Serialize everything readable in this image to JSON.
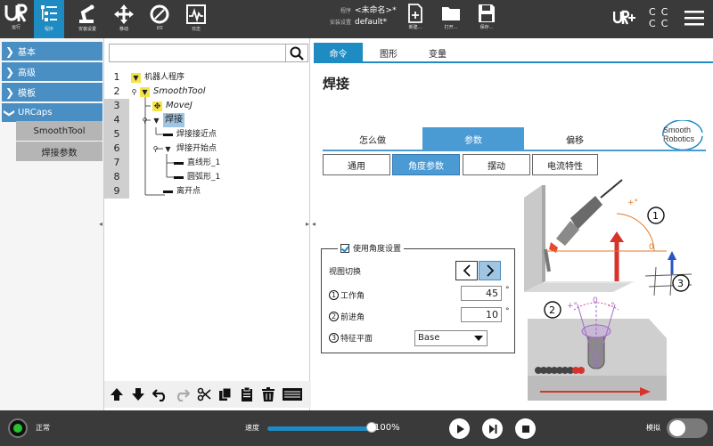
{
  "topbar": {
    "buttons": [
      {
        "label": "运行",
        "icon": "ur-logo-icon"
      },
      {
        "label": "程序",
        "icon": "program-icon"
      },
      {
        "label": "安装设置",
        "icon": "robot-arm-icon"
      },
      {
        "label": "移动",
        "icon": "move-arrows-icon"
      },
      {
        "label": "I/O",
        "icon": "io-icon"
      },
      {
        "label": "日志",
        "icon": "log-icon"
      }
    ],
    "program_key": "程序",
    "program_value": "<未命名>*",
    "install_key": "安装设置",
    "install_value": "default*",
    "file_buttons": [
      {
        "label": "新建...",
        "icon": "new-file-icon"
      },
      {
        "label": "打开...",
        "icon": "folder-icon"
      },
      {
        "label": "保存...",
        "icon": "save-icon"
      }
    ],
    "c_labels": [
      "C",
      "C",
      "C",
      "C"
    ]
  },
  "leftnav": {
    "items": [
      {
        "label": "基本",
        "expanded": false
      },
      {
        "label": "高级",
        "expanded": false
      },
      {
        "label": "模板",
        "expanded": false
      },
      {
        "label": "URCaps",
        "expanded": true
      }
    ],
    "sub_items": [
      "SmoothTool",
      "焊接参数"
    ]
  },
  "tree": {
    "rows": [
      {
        "num": "1",
        "label": "机器人程序"
      },
      {
        "num": "2",
        "label": "SmoothTool"
      },
      {
        "num": "3",
        "label": "MoveJ"
      },
      {
        "num": "4",
        "label": "焊接"
      },
      {
        "num": "5",
        "label": "焊接接近点"
      },
      {
        "num": "6",
        "label": "焊接开始点"
      },
      {
        "num": "7",
        "label": "直线形_1"
      },
      {
        "num": "8",
        "label": "圆弧形_1"
      },
      {
        "num": "9",
        "label": "离开点"
      }
    ]
  },
  "main": {
    "tabs": [
      "命令",
      "图形",
      "变量"
    ],
    "title": "焊接",
    "logo_line1": "Smooth",
    "logo_line2": "Robotics",
    "big_tabs": [
      "怎么做",
      "参数",
      "偏移"
    ],
    "small_tabs": [
      "通用",
      "角度参数",
      "摆动",
      "电流特性"
    ],
    "angle_group_title": "使用角度设置",
    "view_switch_label": "视图切换",
    "work_angle_num": "1",
    "work_angle_label": "工作角",
    "work_angle_value": "45",
    "travel_angle_num": "2",
    "travel_angle_label": "前进角",
    "travel_angle_value": "10",
    "feature_plane_num": "3",
    "feature_plane_label": "特征平面",
    "feature_plane_value": "Base",
    "degree_symbol": "°",
    "diagram": {
      "label_1": "1",
      "label_2": "2",
      "label_3": "3",
      "plus_angle": "+°",
      "minus_angle": "-°",
      "zero": "0"
    }
  },
  "bottombar": {
    "status": "正常",
    "speed_label": "速度",
    "speed_value": "100%",
    "speed_fraction": 1.0,
    "simulation_label": "模拟"
  },
  "colors": {
    "accent": "#1e8bc3",
    "nav_blue": "#4a8fc4",
    "topbar": "#3a3a3a",
    "status_green": "#29c12f"
  }
}
